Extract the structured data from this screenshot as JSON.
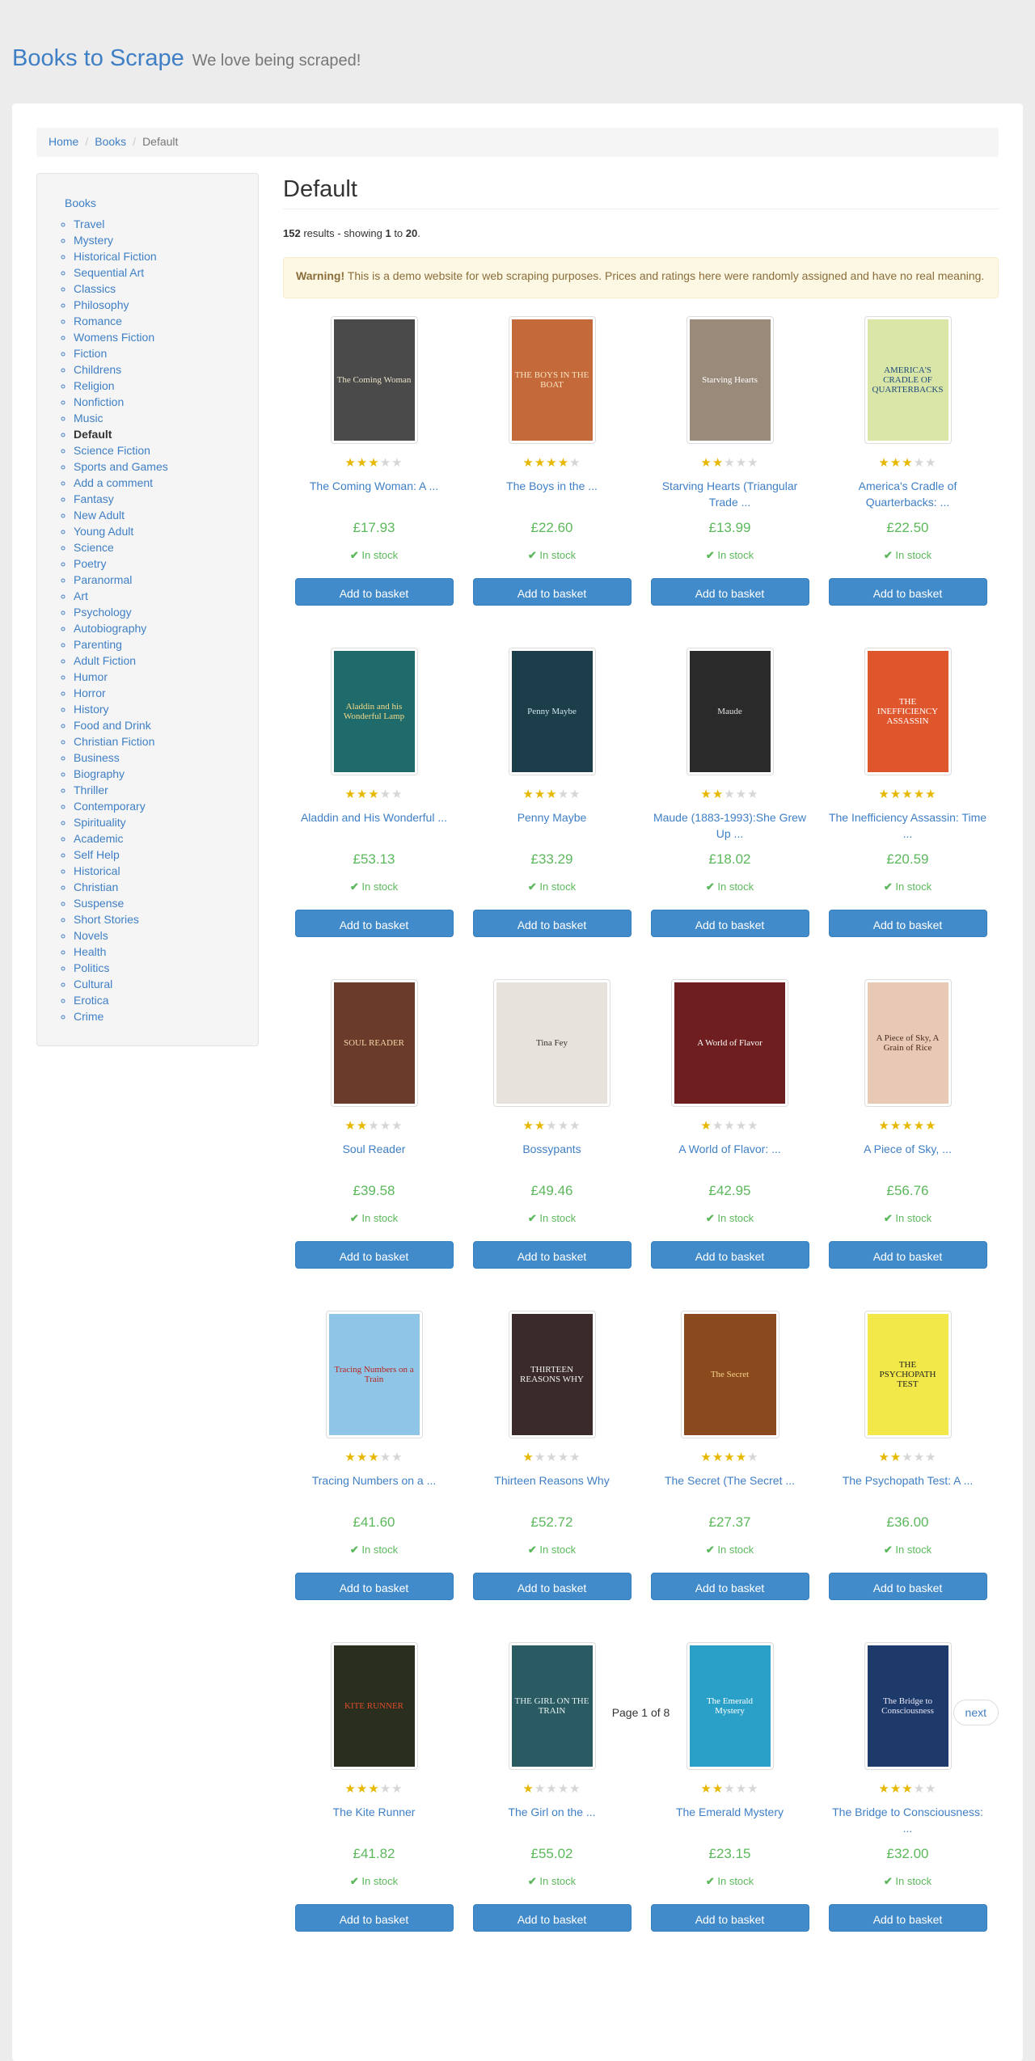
{
  "header": {
    "brand": "Books to Scrape",
    "tagline": "We love being scraped!"
  },
  "breadcrumb": {
    "home": "Home",
    "books": "Books",
    "current": "Default"
  },
  "sidebar": {
    "root": "Books",
    "categories": [
      "Travel",
      "Mystery",
      "Historical Fiction",
      "Sequential Art",
      "Classics",
      "Philosophy",
      "Romance",
      "Womens Fiction",
      "Fiction",
      "Childrens",
      "Religion",
      "Nonfiction",
      "Music",
      "Default",
      "Science Fiction",
      "Sports and Games",
      "Add a comment",
      "Fantasy",
      "New Adult",
      "Young Adult",
      "Science",
      "Poetry",
      "Paranormal",
      "Art",
      "Psychology",
      "Autobiography",
      "Parenting",
      "Adult Fiction",
      "Humor",
      "Horror",
      "History",
      "Food and Drink",
      "Christian Fiction",
      "Business",
      "Biography",
      "Thriller",
      "Contemporary",
      "Spirituality",
      "Academic",
      "Self Help",
      "Historical",
      "Christian",
      "Suspense",
      "Short Stories",
      "Novels",
      "Health",
      "Politics",
      "Cultural",
      "Erotica",
      "Crime"
    ],
    "active": "Default"
  },
  "main": {
    "title": "Default",
    "results": {
      "count": "152",
      "text1": " results - showing ",
      "from": "1",
      "text2": " to ",
      "to": "20",
      "end": "."
    },
    "alert": {
      "strong": "Warning!",
      "text": " This is a demo website for web scraping purposes. Prices and ratings here were randomly assigned and have no real meaning."
    },
    "add_label": "Add to basket",
    "stock_label": "In stock",
    "products": [
      {
        "title": "The Coming Woman: A ...",
        "price": "£17.93",
        "rating": 3,
        "cover_text": "The Coming Woman",
        "cover_bg": "#4a4a4a",
        "cover_fg": "#e8e0c8"
      },
      {
        "title": "The Boys in the ...",
        "price": "£22.60",
        "rating": 4,
        "cover_text": "THE BOYS IN THE BOAT",
        "cover_bg": "#c46a3a",
        "cover_fg": "#fbe3c2"
      },
      {
        "title": "Starving Hearts (Triangular Trade ...",
        "price": "£13.99",
        "rating": 2,
        "cover_text": "Starving Hearts",
        "cover_bg": "#9a8a7a",
        "cover_fg": "#ffffff"
      },
      {
        "title": "America's Cradle of Quarterbacks: ...",
        "price": "£22.50",
        "rating": 3,
        "cover_text": "AMERICA'S CRADLE OF QUARTERBACKS",
        "cover_bg": "#d9e6a8",
        "cover_fg": "#1e4a7a"
      },
      {
        "title": "Aladdin and His Wonderful ...",
        "price": "£53.13",
        "rating": 3,
        "cover_text": "Aladdin and his Wonderful Lamp",
        "cover_bg": "#1f6a6a",
        "cover_fg": "#f2d98a"
      },
      {
        "title": "Penny Maybe",
        "price": "£33.29",
        "rating": 3,
        "cover_text": "Penny Maybe",
        "cover_bg": "#1c3d4a",
        "cover_fg": "#cfe6ee"
      },
      {
        "title": "Maude (1883-1993):She Grew Up ...",
        "price": "£18.02",
        "rating": 2,
        "cover_text": "Maude",
        "cover_bg": "#2a2a2a",
        "cover_fg": "#e0e0e0"
      },
      {
        "title": "The Inefficiency Assassin: Time ...",
        "price": "£20.59",
        "rating": 5,
        "cover_text": "THE INEFFICIENCY ASSASSIN",
        "cover_bg": "#e0562c",
        "cover_fg": "#ffffff"
      },
      {
        "title": "Soul Reader",
        "price": "£39.58",
        "rating": 2,
        "cover_text": "SOUL READER",
        "cover_bg": "#6a3a2a",
        "cover_fg": "#f3d7a8"
      },
      {
        "title": "Bossypants",
        "price": "£49.46",
        "rating": 2,
        "cover_text": "Tina Fey",
        "cover_bg": "#e8e2dc",
        "cover_fg": "#333333"
      },
      {
        "title": "A World of Flavor: ...",
        "price": "£42.95",
        "rating": 1,
        "cover_text": "A World of Flavor",
        "cover_bg": "#6e1e1e",
        "cover_fg": "#ffffff"
      },
      {
        "title": "A Piece of Sky, ...",
        "price": "£56.76",
        "rating": 5,
        "cover_text": "A Piece of Sky, A Grain of Rice",
        "cover_bg": "#e8c9b5",
        "cover_fg": "#4a2c20"
      },
      {
        "title": "Tracing Numbers on a ...",
        "price": "£41.60",
        "rating": 3,
        "cover_text": "Tracing Numbers on a Train",
        "cover_bg": "#8fc6e8",
        "cover_fg": "#b8251e"
      },
      {
        "title": "Thirteen Reasons Why",
        "price": "£52.72",
        "rating": 1,
        "cover_text": "THIRTEEN REASONS WHY",
        "cover_bg": "#3a2a2a",
        "cover_fg": "#f2f2f2"
      },
      {
        "title": "The Secret (The Secret ...",
        "price": "£27.37",
        "rating": 4,
        "cover_text": "The Secret",
        "cover_bg": "#8a4a1e",
        "cover_fg": "#f3d08a"
      },
      {
        "title": "The Psychopath Test: A ...",
        "price": "£36.00",
        "rating": 2,
        "cover_text": "THE PSYCHOPATH TEST",
        "cover_bg": "#f2e84a",
        "cover_fg": "#222222"
      },
      {
        "title": "The Kite Runner",
        "price": "£41.82",
        "rating": 3,
        "cover_text": "KITE RUNNER",
        "cover_bg": "#2a2e1e",
        "cover_fg": "#e04a2a"
      },
      {
        "title": "The Girl on the ...",
        "price": "£55.02",
        "rating": 1,
        "cover_text": "THE GIRL ON THE TRAIN",
        "cover_bg": "#2a5a62",
        "cover_fg": "#e6f2f2"
      },
      {
        "title": "The Emerald Mystery",
        "price": "£23.15",
        "rating": 2,
        "cover_text": "The Emerald Mystery",
        "cover_bg": "#2aa0c8",
        "cover_fg": "#ffffff"
      },
      {
        "title": "The Bridge to Consciousness: ...",
        "price": "£32.00",
        "rating": 3,
        "cover_text": "The Bridge to Consciousness",
        "cover_bg": "#1e3a6a",
        "cover_fg": "#e8e8f8"
      }
    ]
  },
  "pager": {
    "current": "Page 1 of 8",
    "next": "next"
  },
  "colors": {
    "link": "#3f7fc5",
    "price": "#5cb85c",
    "button": "#428bca",
    "star": "#e6b800"
  },
  "icons": {
    "stock": "check-icon",
    "rating": "star-icon"
  }
}
